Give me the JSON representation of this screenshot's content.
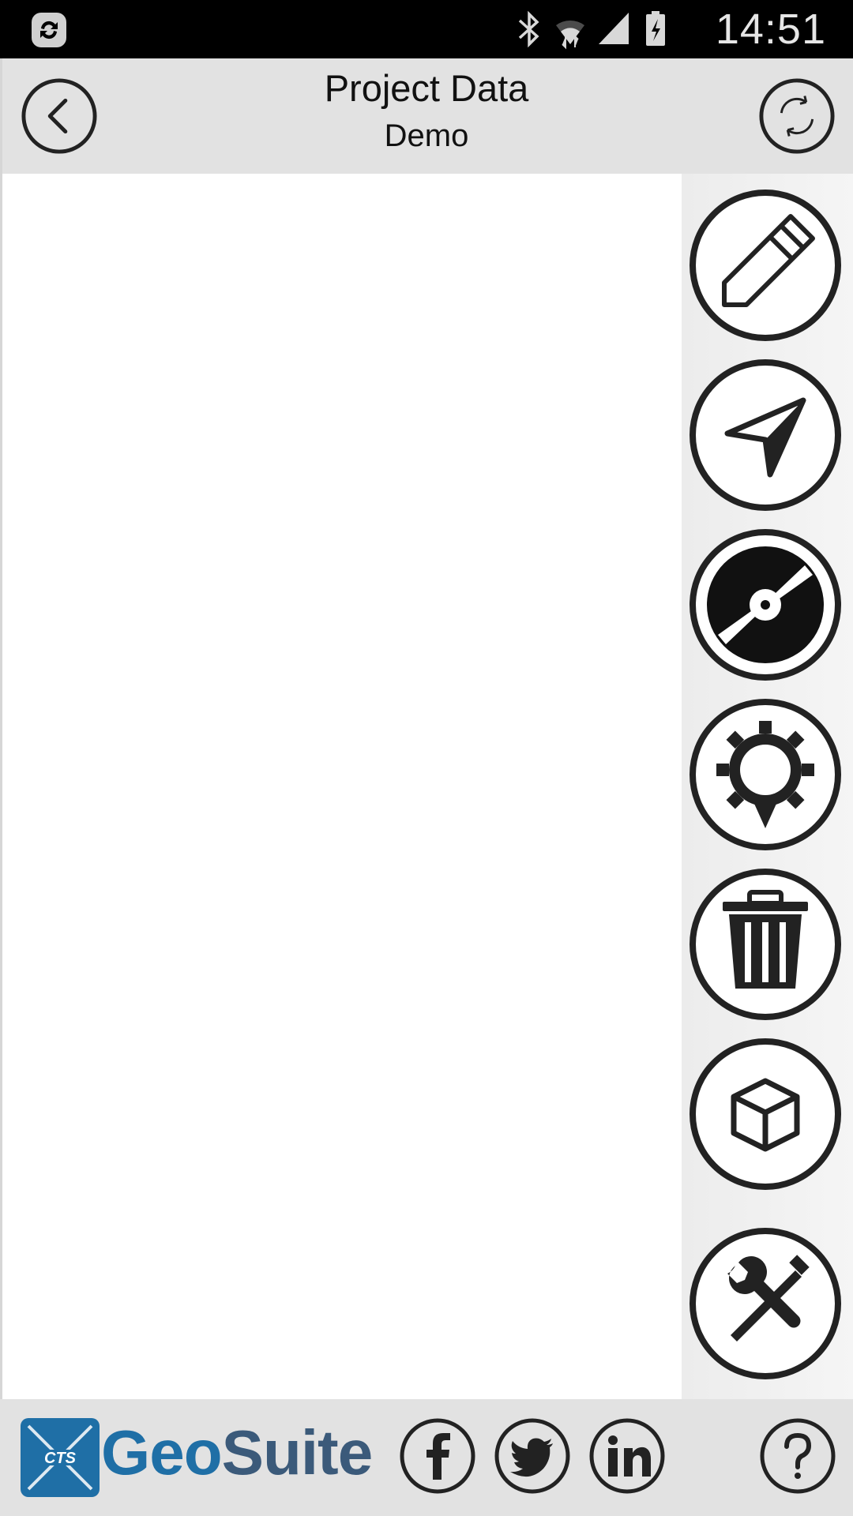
{
  "status_bar": {
    "time": "14:51",
    "icons": [
      "sync-app-icon",
      "bluetooth-icon",
      "wifi-icon",
      "signal-icon",
      "battery-charging-icon"
    ]
  },
  "header": {
    "title": "Project Data",
    "subtitle": "Demo",
    "left_button_icon": "back-arrow-icon",
    "right_button_icon": "sync-icon"
  },
  "side_toolbar": {
    "buttons": [
      {
        "icon": "pencil-icon"
      },
      {
        "icon": "navigate-icon"
      },
      {
        "icon": "disc-icon"
      },
      {
        "icon": "gear-location-icon"
      },
      {
        "icon": "trash-icon"
      },
      {
        "icon": "cube-icon"
      },
      {
        "icon": "tools-icon"
      }
    ]
  },
  "footer": {
    "brand_geo": "Geo",
    "brand_suite": "Suite",
    "logo_text": "CTS",
    "social": [
      "facebook-icon",
      "twitter-icon",
      "linkedin-icon"
    ],
    "help_icon": "help-icon",
    "brand_color": "#1f6fa6"
  }
}
